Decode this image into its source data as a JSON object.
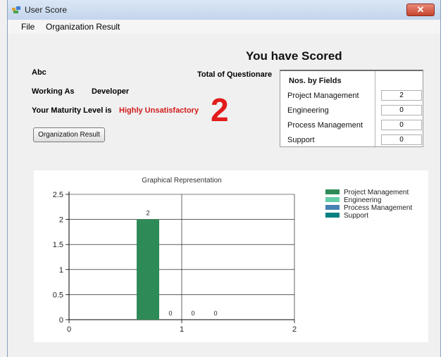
{
  "window": {
    "title": "User Score",
    "close_label": "✕"
  },
  "menu": {
    "items": [
      "File",
      "Organization Result"
    ]
  },
  "header": {
    "heading": "You have Scored"
  },
  "user": {
    "name": "Abc",
    "working_as_label": "Working As",
    "working_as_value": "Developer",
    "maturity_label": "Your Maturity Level is",
    "maturity_value": "Highly Unsatisfactory"
  },
  "score": {
    "total_label": "Total of Questionare",
    "value": "2"
  },
  "buttons": {
    "org_result": "Organization Result"
  },
  "fields": {
    "header": "Nos. by Fields",
    "rows": [
      {
        "label": "Project Management",
        "value": "2"
      },
      {
        "label": "Engineering",
        "value": "0"
      },
      {
        "label": "Process Management",
        "value": "0"
      },
      {
        "label": "Support",
        "value": "0"
      }
    ]
  },
  "colors": {
    "accent_red": "#e21b1b",
    "bar_project": "#2e8b57",
    "bar_engineering": "#66cdaa",
    "bar_process": "#4682b4",
    "bar_support": "#008080"
  },
  "chart_data": {
    "type": "bar",
    "title": "Graphical Representation",
    "x_ticks": [
      "0",
      "1",
      "2"
    ],
    "y_ticks": [
      "0",
      "0.5",
      "1",
      "1.5",
      "2",
      "2.5"
    ],
    "xlim": [
      0,
      2
    ],
    "ylim": [
      0,
      2.5
    ],
    "grid": true,
    "legend_position": "top-right",
    "series": [
      {
        "name": "Project Management",
        "x": 0.7,
        "value": 2,
        "label": "2",
        "color": "#2e8b57"
      },
      {
        "name": "Engineering",
        "x": 0.9,
        "value": 0,
        "label": "0",
        "color": "#66cdaa"
      },
      {
        "name": "Process Management",
        "x": 1.1,
        "value": 0,
        "label": "0",
        "color": "#4682b4"
      },
      {
        "name": "Support",
        "x": 1.3,
        "value": 0,
        "label": "0",
        "color": "#008080"
      }
    ]
  }
}
